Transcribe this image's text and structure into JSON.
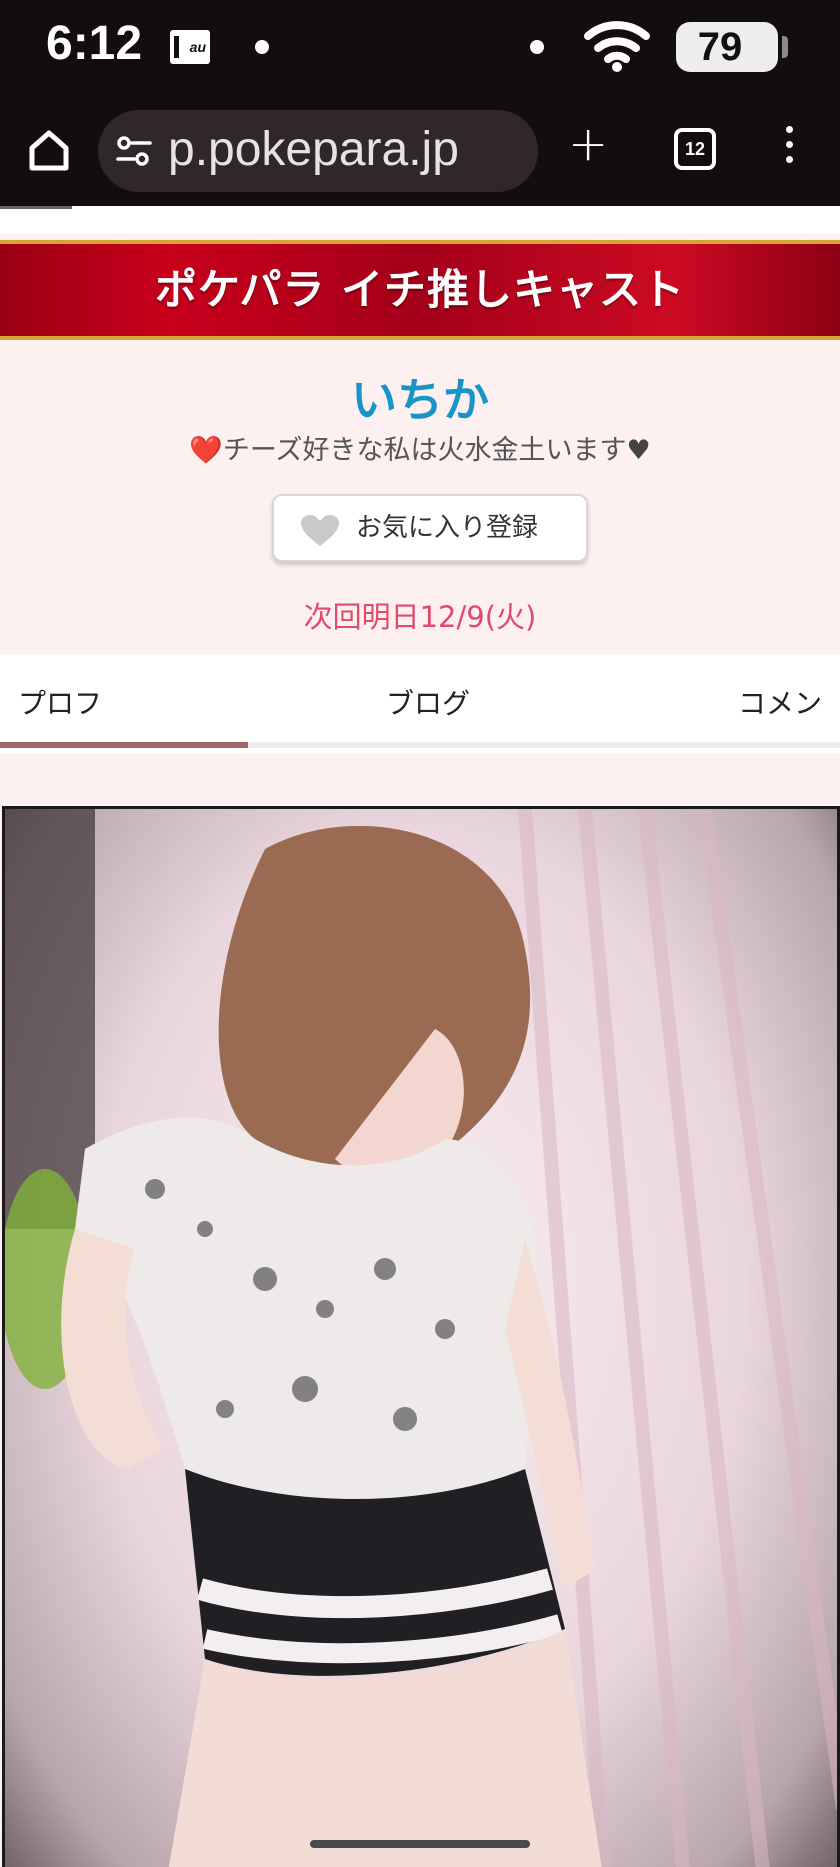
{
  "status_bar": {
    "time": "6:12",
    "carrier_icon": "au-icon",
    "battery": "79"
  },
  "browser": {
    "url": "p.pokepara.jp",
    "tab_count": "12"
  },
  "page": {
    "banner_title": "ポケパラ イチ推しキャスト",
    "cast_name": "いちか",
    "catch_heart_start": "❤️",
    "catch_text": "チーズ好きな私は火水金土います",
    "catch_heart_end": "♥",
    "favorite_button": "お気に入り登録",
    "next_schedule": "次回明日12/9(火)",
    "tabs": [
      "プロフ",
      "ブログ",
      "コメン"
    ],
    "active_tab": "プロフ"
  },
  "colors": {
    "banner": "#c8001b",
    "banner_border": "#d7a533",
    "cast_name": "#1894c6",
    "next_schedule": "#e04a6c",
    "tab_indicator": "#a06868"
  }
}
